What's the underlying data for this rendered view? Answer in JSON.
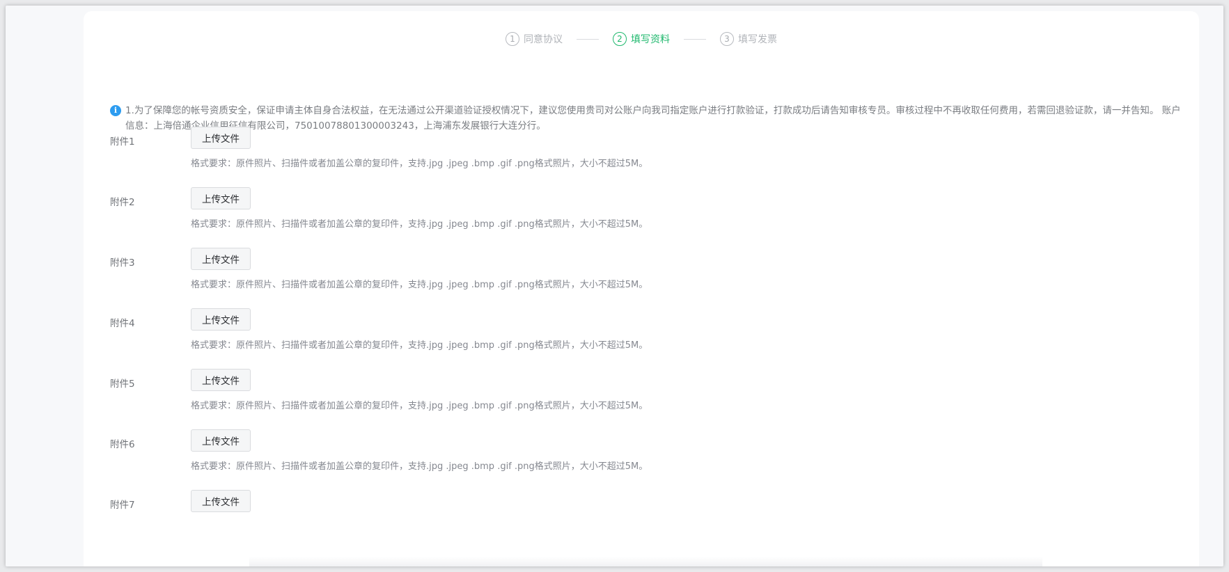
{
  "steps": [
    {
      "num": "1",
      "label": "同意协议",
      "state": "done"
    },
    {
      "num": "2",
      "label": "填写资料",
      "state": "active"
    },
    {
      "num": "3",
      "label": "填写发票",
      "state": "pending"
    }
  ],
  "notice": {
    "icon": "info-icon",
    "text": "1.为了保障您的帐号资质安全，保证申请主体自身合法权益，在无法通过公开渠道验证授权情况下，建议您使用贵司对公账户向我司指定账户进行打款验证，打款成功后请告知审核专员。审核过程中不再收取任何费用，若需回退验证款，请一并告知。 账户信息：上海倍通企业信用征信有限公司，75010078801300003243，上海浦东发展银行大连分行。"
  },
  "attachments": [
    {
      "label": "附件1",
      "button": "上传文件",
      "hint": "格式要求：原件照片、扫描件或者加盖公章的复印件，支持.jpg .jpeg .bmp .gif .png格式照片，大小不超过5M。"
    },
    {
      "label": "附件2",
      "button": "上传文件",
      "hint": "格式要求：原件照片、扫描件或者加盖公章的复印件，支持.jpg .jpeg .bmp .gif .png格式照片，大小不超过5M。"
    },
    {
      "label": "附件3",
      "button": "上传文件",
      "hint": "格式要求：原件照片、扫描件或者加盖公章的复印件，支持.jpg .jpeg .bmp .gif .png格式照片，大小不超过5M。"
    },
    {
      "label": "附件4",
      "button": "上传文件",
      "hint": "格式要求：原件照片、扫描件或者加盖公章的复印件，支持.jpg .jpeg .bmp .gif .png格式照片，大小不超过5M。"
    },
    {
      "label": "附件5",
      "button": "上传文件",
      "hint": "格式要求：原件照片、扫描件或者加盖公章的复印件，支持.jpg .jpeg .bmp .gif .png格式照片，大小不超过5M。"
    },
    {
      "label": "附件6",
      "button": "上传文件",
      "hint": "格式要求：原件照片、扫描件或者加盖公章的复印件，支持.jpg .jpeg .bmp .gif .png格式照片，大小不超过5M。"
    },
    {
      "label": "附件7",
      "button": "上传文件",
      "hint": ""
    }
  ],
  "colors": {
    "accent_green": "#1fb86d",
    "info_blue": "#2d9cf0",
    "inactive_gray": "#b0b3b8"
  }
}
